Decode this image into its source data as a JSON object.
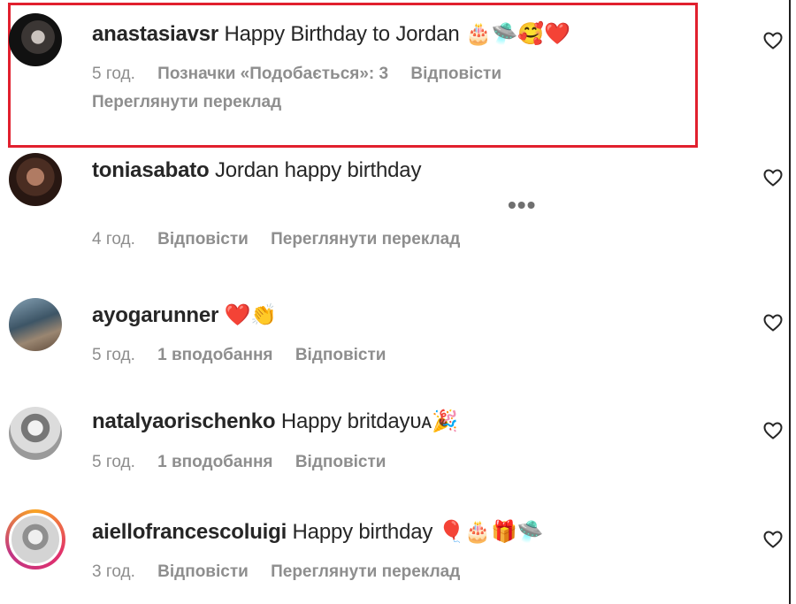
{
  "comments": [
    {
      "username": "anastasiavsr",
      "text": "Happy Birthday to Jordan",
      "emojis": "🎂🛸🥰❤️",
      "time": "5 год.",
      "likes": "Позначки «Подобається»: 3",
      "reply": "Відповісти",
      "translate": "Переглянути переклад",
      "highlighted": true
    },
    {
      "username": "toniasabato",
      "text": "Jordan happy birthday",
      "time": "4 год.",
      "reply": "Відповісти",
      "translate": "Переглянути переклад"
    },
    {
      "username": "ayogarunner",
      "text": "",
      "emojis": "❤️👏",
      "time": "5 год.",
      "likes": "1 вподобання",
      "reply": "Відповісти"
    },
    {
      "username": "natalyaorischenko",
      "text": "Happy britday",
      "emojis": "ᴜᴀ🎉",
      "time": "5 год.",
      "likes": "1 вподобання",
      "reply": "Відповісти"
    },
    {
      "username": "aiellofrancescoluigi",
      "text": "Happy birthday",
      "emojis": "🎈🎂🎁🛸",
      "time": "3 год.",
      "reply": "Відповісти",
      "translate": "Переглянути переклад"
    }
  ],
  "more_options": "•••",
  "icons": {
    "like": "heart-outline-icon",
    "more": "more-options-icon"
  },
  "colors": {
    "highlight_border": "#e1202e",
    "meta_text": "#8e8e8e",
    "primary_text": "#262626"
  }
}
